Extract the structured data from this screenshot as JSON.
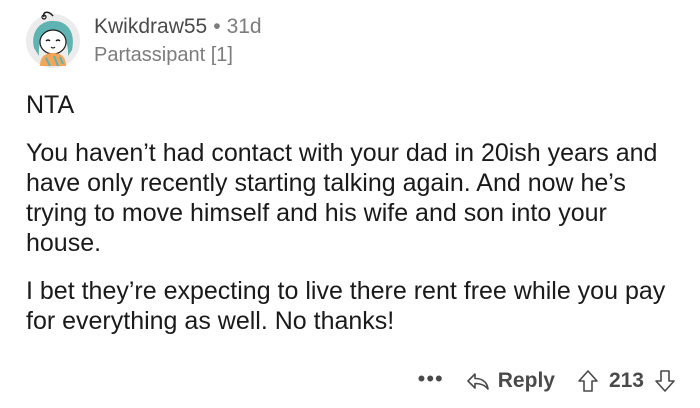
{
  "comment": {
    "username": "Kwikdraw55",
    "separator": "•",
    "age": "31d",
    "flair": "Partassipant [1]",
    "paragraphs": [
      "NTA",
      "You haven’t had contact with your dad in 20ish years and have only recently starting talking again. And now he’s trying to move himself and his wife and son into your house.",
      "I bet they’re expecting to live there rent free while you pay for everything as well. No thanks!"
    ]
  },
  "actions": {
    "more_label": "•••",
    "reply_label": "Reply",
    "vote_count": "213"
  },
  "icons": {
    "avatar": "avatar-icon",
    "reply": "reply-arrow-icon",
    "upvote": "upvote-icon",
    "downvote": "downvote-icon"
  },
  "colors": {
    "text": "#1a1a1b",
    "meta": "#7c7c7c",
    "action": "#4a4a4a",
    "avatar_hair": "#5fb3b3",
    "avatar_bg": "#e8e8e8"
  }
}
